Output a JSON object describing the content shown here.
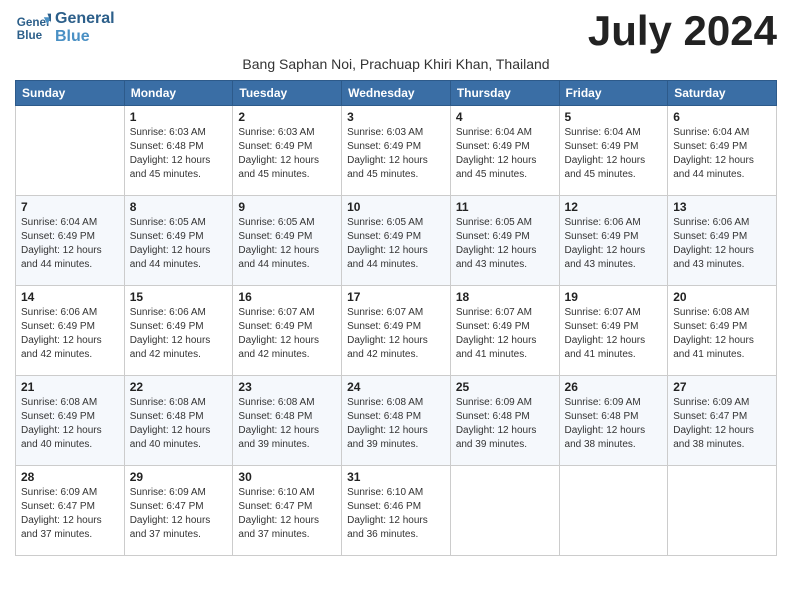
{
  "header": {
    "logo_line1": "General",
    "logo_line2": "Blue",
    "month": "July 2024",
    "subtitle": "Bang Saphan Noi, Prachuap Khiri Khan, Thailand"
  },
  "weekdays": [
    "Sunday",
    "Monday",
    "Tuesday",
    "Wednesday",
    "Thursday",
    "Friday",
    "Saturday"
  ],
  "weeks": [
    [
      {
        "day": "",
        "info": ""
      },
      {
        "day": "1",
        "info": "Sunrise: 6:03 AM\nSunset: 6:48 PM\nDaylight: 12 hours\nand 45 minutes."
      },
      {
        "day": "2",
        "info": "Sunrise: 6:03 AM\nSunset: 6:49 PM\nDaylight: 12 hours\nand 45 minutes."
      },
      {
        "day": "3",
        "info": "Sunrise: 6:03 AM\nSunset: 6:49 PM\nDaylight: 12 hours\nand 45 minutes."
      },
      {
        "day": "4",
        "info": "Sunrise: 6:04 AM\nSunset: 6:49 PM\nDaylight: 12 hours\nand 45 minutes."
      },
      {
        "day": "5",
        "info": "Sunrise: 6:04 AM\nSunset: 6:49 PM\nDaylight: 12 hours\nand 45 minutes."
      },
      {
        "day": "6",
        "info": "Sunrise: 6:04 AM\nSunset: 6:49 PM\nDaylight: 12 hours\nand 44 minutes."
      }
    ],
    [
      {
        "day": "7",
        "info": "Sunrise: 6:04 AM\nSunset: 6:49 PM\nDaylight: 12 hours\nand 44 minutes."
      },
      {
        "day": "8",
        "info": "Sunrise: 6:05 AM\nSunset: 6:49 PM\nDaylight: 12 hours\nand 44 minutes."
      },
      {
        "day": "9",
        "info": "Sunrise: 6:05 AM\nSunset: 6:49 PM\nDaylight: 12 hours\nand 44 minutes."
      },
      {
        "day": "10",
        "info": "Sunrise: 6:05 AM\nSunset: 6:49 PM\nDaylight: 12 hours\nand 44 minutes."
      },
      {
        "day": "11",
        "info": "Sunrise: 6:05 AM\nSunset: 6:49 PM\nDaylight: 12 hours\nand 43 minutes."
      },
      {
        "day": "12",
        "info": "Sunrise: 6:06 AM\nSunset: 6:49 PM\nDaylight: 12 hours\nand 43 minutes."
      },
      {
        "day": "13",
        "info": "Sunrise: 6:06 AM\nSunset: 6:49 PM\nDaylight: 12 hours\nand 43 minutes."
      }
    ],
    [
      {
        "day": "14",
        "info": "Sunrise: 6:06 AM\nSunset: 6:49 PM\nDaylight: 12 hours\nand 42 minutes."
      },
      {
        "day": "15",
        "info": "Sunrise: 6:06 AM\nSunset: 6:49 PM\nDaylight: 12 hours\nand 42 minutes."
      },
      {
        "day": "16",
        "info": "Sunrise: 6:07 AM\nSunset: 6:49 PM\nDaylight: 12 hours\nand 42 minutes."
      },
      {
        "day": "17",
        "info": "Sunrise: 6:07 AM\nSunset: 6:49 PM\nDaylight: 12 hours\nand 42 minutes."
      },
      {
        "day": "18",
        "info": "Sunrise: 6:07 AM\nSunset: 6:49 PM\nDaylight: 12 hours\nand 41 minutes."
      },
      {
        "day": "19",
        "info": "Sunrise: 6:07 AM\nSunset: 6:49 PM\nDaylight: 12 hours\nand 41 minutes."
      },
      {
        "day": "20",
        "info": "Sunrise: 6:08 AM\nSunset: 6:49 PM\nDaylight: 12 hours\nand 41 minutes."
      }
    ],
    [
      {
        "day": "21",
        "info": "Sunrise: 6:08 AM\nSunset: 6:49 PM\nDaylight: 12 hours\nand 40 minutes."
      },
      {
        "day": "22",
        "info": "Sunrise: 6:08 AM\nSunset: 6:48 PM\nDaylight: 12 hours\nand 40 minutes."
      },
      {
        "day": "23",
        "info": "Sunrise: 6:08 AM\nSunset: 6:48 PM\nDaylight: 12 hours\nand 39 minutes."
      },
      {
        "day": "24",
        "info": "Sunrise: 6:08 AM\nSunset: 6:48 PM\nDaylight: 12 hours\nand 39 minutes."
      },
      {
        "day": "25",
        "info": "Sunrise: 6:09 AM\nSunset: 6:48 PM\nDaylight: 12 hours\nand 39 minutes."
      },
      {
        "day": "26",
        "info": "Sunrise: 6:09 AM\nSunset: 6:48 PM\nDaylight: 12 hours\nand 38 minutes."
      },
      {
        "day": "27",
        "info": "Sunrise: 6:09 AM\nSunset: 6:47 PM\nDaylight: 12 hours\nand 38 minutes."
      }
    ],
    [
      {
        "day": "28",
        "info": "Sunrise: 6:09 AM\nSunset: 6:47 PM\nDaylight: 12 hours\nand 37 minutes."
      },
      {
        "day": "29",
        "info": "Sunrise: 6:09 AM\nSunset: 6:47 PM\nDaylight: 12 hours\nand 37 minutes."
      },
      {
        "day": "30",
        "info": "Sunrise: 6:10 AM\nSunset: 6:47 PM\nDaylight: 12 hours\nand 37 minutes."
      },
      {
        "day": "31",
        "info": "Sunrise: 6:10 AM\nSunset: 6:46 PM\nDaylight: 12 hours\nand 36 minutes."
      },
      {
        "day": "",
        "info": ""
      },
      {
        "day": "",
        "info": ""
      },
      {
        "day": "",
        "info": ""
      }
    ]
  ]
}
